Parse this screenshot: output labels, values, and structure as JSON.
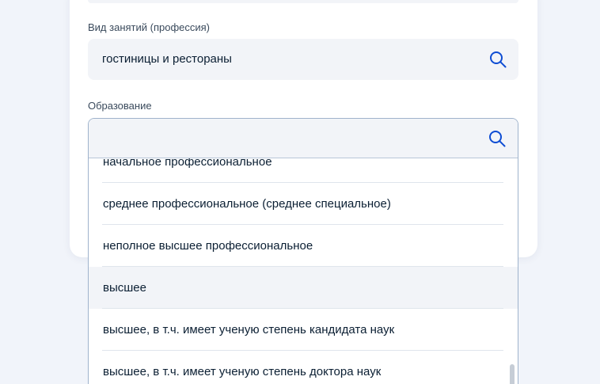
{
  "form": {
    "profession": {
      "label": "Вид занятий (профессия)",
      "value": "гостиницы и рестораны"
    },
    "education": {
      "label": "Образование",
      "value": "",
      "options": [
        "начальное профессиональное",
        "среднее профессиональное (среднее специальное)",
        "неполное высшее профессиональное",
        "высшее",
        "высшее, в т.ч. имеет ученую степень кандидата наук",
        "высшее, в т.ч. имеет ученую степень доктора наук"
      ],
      "hovered_option": "высшее"
    }
  },
  "icons": {
    "search": "search-icon"
  },
  "colors": {
    "page_bg": "#f1f4fa",
    "field_bg": "#f2f4f8",
    "focus_border": "#9fb3cc",
    "icon": "#0d4cd3",
    "text": "#0b1f33"
  }
}
